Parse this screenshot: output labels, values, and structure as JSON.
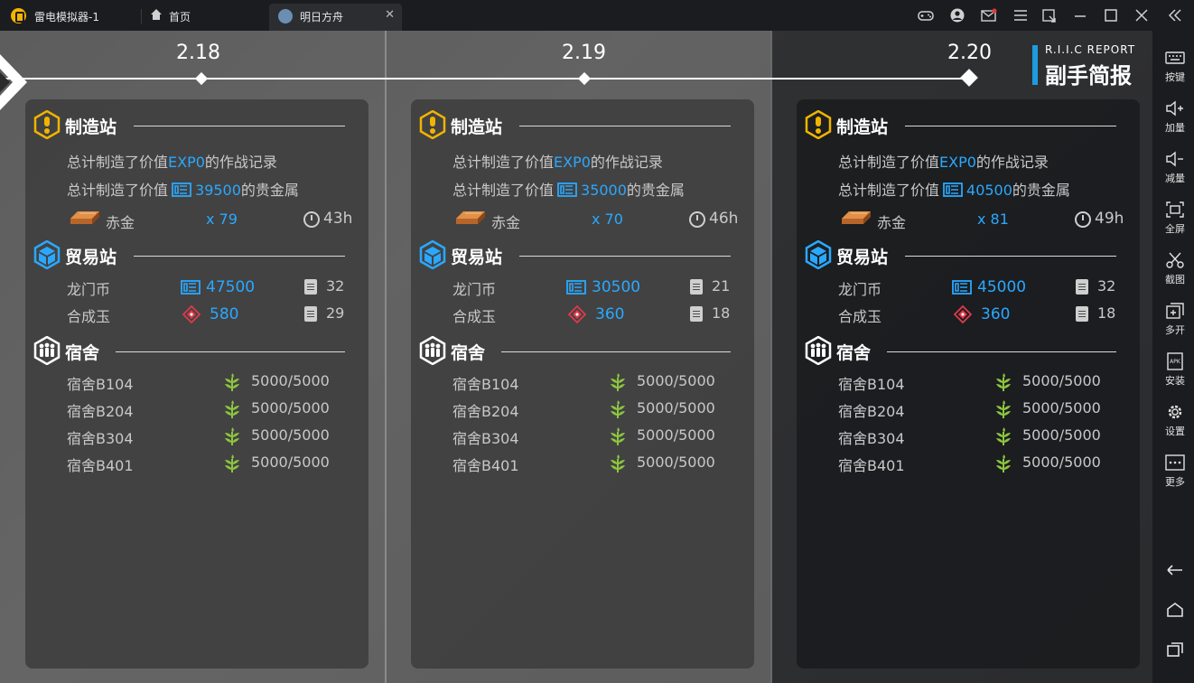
{
  "titlebar": {
    "app_title": "雷电模拟器-1",
    "home_label": "首页",
    "tab_label": "明日方舟",
    "tab_close": "✕"
  },
  "sidebar": {
    "items": [
      {
        "label": "按键",
        "icon": "keyboard-icon"
      },
      {
        "label": "加量",
        "icon": "volume-up-icon"
      },
      {
        "label": "减量",
        "icon": "volume-down-icon"
      },
      {
        "label": "全屏",
        "icon": "fullscreen-icon"
      },
      {
        "label": "截图",
        "icon": "scissors-icon"
      },
      {
        "label": "多开",
        "icon": "multi-instance-icon"
      },
      {
        "label": "安装",
        "icon": "apk-icon"
      },
      {
        "label": "设置",
        "icon": "gear-icon"
      },
      {
        "label": "更多",
        "icon": "more-icon"
      }
    ]
  },
  "report": {
    "en": "R.I.I.C REPORT",
    "cn": "副手简报"
  },
  "colors": {
    "accent": "#2aa8ff",
    "gold": "#f0b400"
  },
  "days": [
    {
      "date": "2.18",
      "factory": {
        "title": "制造站",
        "exp_prefix": "总计制造了价值",
        "exp_value": "EXP0",
        "exp_suffix": "的作战记录",
        "gold_prefix": "总计制造了价值",
        "gold_value": "39500",
        "gold_suffix": "的贵金属",
        "item_name": "赤金",
        "item_count": "x 79",
        "item_time": "43h"
      },
      "trade": {
        "title": "贸易站",
        "lmd_label": "龙门币",
        "lmd_value": "47500",
        "lmd_orders": "32",
        "orundum_label": "合成玉",
        "orundum_value": "580",
        "orundum_orders": "29"
      },
      "dorm": {
        "title": "宿舍",
        "rooms": [
          {
            "name": "宿舍B104",
            "value": "5000/5000"
          },
          {
            "name": "宿舍B204",
            "value": "5000/5000"
          },
          {
            "name": "宿舍B304",
            "value": "5000/5000"
          },
          {
            "name": "宿舍B401",
            "value": "5000/5000"
          }
        ]
      }
    },
    {
      "date": "2.19",
      "factory": {
        "title": "制造站",
        "exp_prefix": "总计制造了价值",
        "exp_value": "EXP0",
        "exp_suffix": "的作战记录",
        "gold_prefix": "总计制造了价值",
        "gold_value": "35000",
        "gold_suffix": "的贵金属",
        "item_name": "赤金",
        "item_count": "x 70",
        "item_time": "46h"
      },
      "trade": {
        "title": "贸易站",
        "lmd_label": "龙门币",
        "lmd_value": "30500",
        "lmd_orders": "21",
        "orundum_label": "合成玉",
        "orundum_value": "360",
        "orundum_orders": "18"
      },
      "dorm": {
        "title": "宿舍",
        "rooms": [
          {
            "name": "宿舍B104",
            "value": "5000/5000"
          },
          {
            "name": "宿舍B204",
            "value": "5000/5000"
          },
          {
            "name": "宿舍B304",
            "value": "5000/5000"
          },
          {
            "name": "宿舍B401",
            "value": "5000/5000"
          }
        ]
      }
    },
    {
      "date": "2.20",
      "factory": {
        "title": "制造站",
        "exp_prefix": "总计制造了价值",
        "exp_value": "EXP0",
        "exp_suffix": "的作战记录",
        "gold_prefix": "总计制造了价值",
        "gold_value": "40500",
        "gold_suffix": "的贵金属",
        "item_name": "赤金",
        "item_count": "x 81",
        "item_time": "49h"
      },
      "trade": {
        "title": "贸易站",
        "lmd_label": "龙门币",
        "lmd_value": "45000",
        "lmd_orders": "32",
        "orundum_label": "合成玉",
        "orundum_value": "360",
        "orundum_orders": "18"
      },
      "dorm": {
        "title": "宿舍",
        "rooms": [
          {
            "name": "宿舍B104",
            "value": "5000/5000"
          },
          {
            "name": "宿舍B204",
            "value": "5000/5000"
          },
          {
            "name": "宿舍B304",
            "value": "5000/5000"
          },
          {
            "name": "宿舍B401",
            "value": "5000/5000"
          }
        ]
      }
    }
  ]
}
